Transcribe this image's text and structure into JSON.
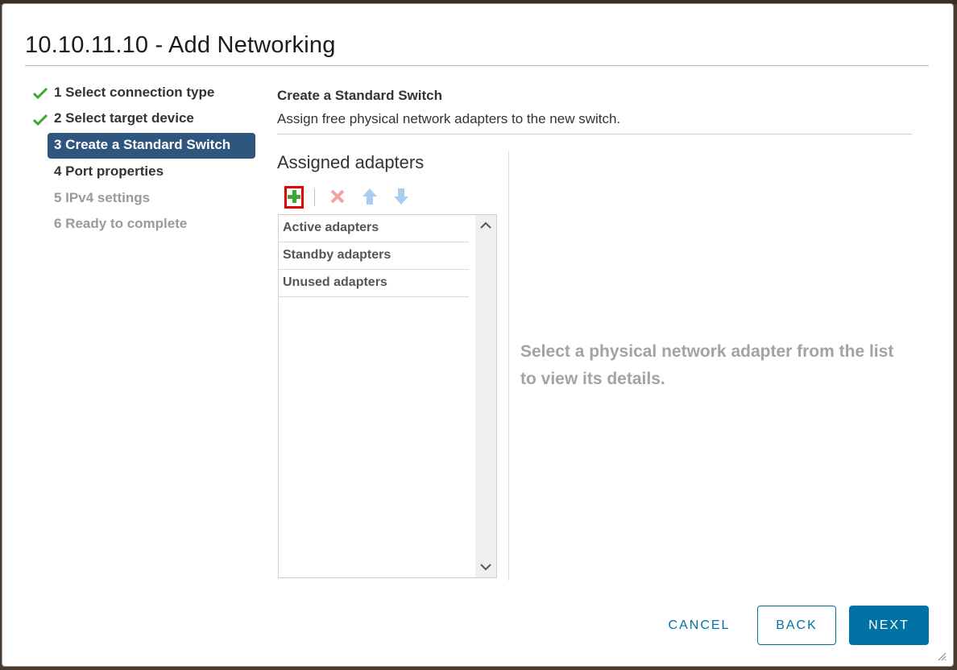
{
  "dialog": {
    "title": "10.10.11.10 - Add Networking"
  },
  "steps": [
    {
      "label": "1 Select connection type",
      "state": "completed"
    },
    {
      "label": "2 Select target device",
      "state": "completed"
    },
    {
      "label": "3 Create a Standard Switch",
      "state": "active"
    },
    {
      "label": "4 Port properties",
      "state": "pending"
    },
    {
      "label": "5 IPv4 settings",
      "state": "disabled"
    },
    {
      "label": "6 Ready to complete",
      "state": "disabled"
    }
  ],
  "content": {
    "section_title": "Create a Standard Switch",
    "section_description": "Assign free physical network adapters to the new switch.",
    "assigned_title": "Assigned adapters",
    "toolbar": {
      "add_icon": "plus-icon",
      "remove_icon": "x-icon",
      "move_up_icon": "arrow-up-icon",
      "move_down_icon": "arrow-down-icon"
    },
    "adapter_groups": [
      "Active adapters",
      "Standby adapters",
      "Unused adapters"
    ],
    "details_placeholder": "Select a physical network adapter from the list to view its details."
  },
  "footer": {
    "cancel_label": "CANCEL",
    "back_label": "BACK",
    "next_label": "NEXT"
  },
  "colors": {
    "accent": "#0072a3",
    "active_step": "#2f567f",
    "check": "#3fa535",
    "highlight": "#e00000"
  }
}
